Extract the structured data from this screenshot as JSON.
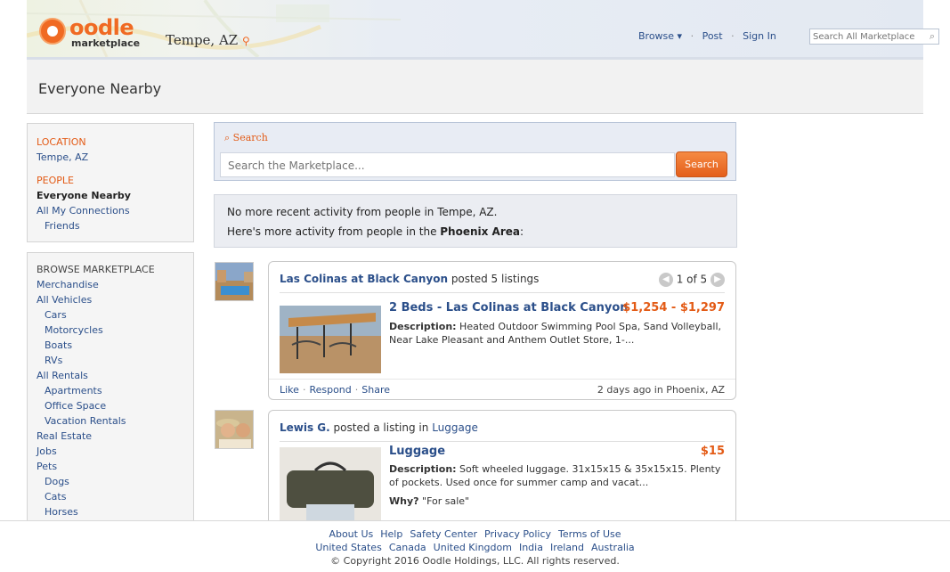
{
  "header": {
    "logo_text": "oodle",
    "logo_subtext": "marketplace",
    "location": "Tempe, AZ",
    "nav": {
      "browse": "Browse ▾",
      "post": "Post",
      "sep": "·",
      "signin": "Sign In"
    },
    "search_placeholder": "Search All Marketplace"
  },
  "page_title": "Everyone Nearby",
  "sidebar": {
    "location_heading": "LOCATION",
    "location_value": "Tempe, AZ",
    "people_heading": "PEOPLE",
    "people_items": [
      "Everyone Nearby",
      "All My Connections",
      "Friends"
    ],
    "browse_heading": "BROWSE MARKETPLACE",
    "browse_items": [
      {
        "label": "Merchandise",
        "indent": false
      },
      {
        "label": "All Vehicles",
        "indent": false
      },
      {
        "label": "Cars",
        "indent": true
      },
      {
        "label": "Motorcycles",
        "indent": true
      },
      {
        "label": "Boats",
        "indent": true
      },
      {
        "label": "RVs",
        "indent": true
      },
      {
        "label": "All Rentals",
        "indent": false
      },
      {
        "label": "Apartments",
        "indent": true
      },
      {
        "label": "Office Space",
        "indent": true
      },
      {
        "label": "Vacation Rentals",
        "indent": true
      },
      {
        "label": "Real Estate",
        "indent": false
      },
      {
        "label": "Jobs",
        "indent": false
      },
      {
        "label": "Pets",
        "indent": false
      },
      {
        "label": "Dogs",
        "indent": true
      },
      {
        "label": "Cats",
        "indent": true
      },
      {
        "label": "Horses",
        "indent": true
      }
    ]
  },
  "search": {
    "label": "Search",
    "placeholder": "Search the Marketplace...",
    "button": "Search"
  },
  "notice": {
    "line1": "No more recent activity from people in Tempe, AZ.",
    "line2_prefix": "Here's more activity from people in the ",
    "line2_bold": "Phoenix Area",
    "line2_suffix": ":"
  },
  "feed": [
    {
      "poster": "Las Colinas at Black Canyon",
      "action": " posted 5 listings",
      "pager": "1 of 5",
      "title": "2 Beds - Las Colinas at Black Canyon",
      "price": "$1,254 - $1,297",
      "desc_label": "Description:",
      "desc": " Heated Outdoor Swimming Pool Spa, Sand Volleyball, Near Lake Pleasant and Anthem Outlet Store, 1-...",
      "actions": [
        "Like",
        "Respond",
        "Share"
      ],
      "meta": "2 days ago in Phoenix, AZ"
    },
    {
      "poster": "Lewis G.",
      "action": " posted a listing in ",
      "category": "Luggage",
      "title": "Luggage",
      "price": "$15",
      "desc_label": "Description:",
      "desc": " Soft wheeled luggage. 31x15x15 & 35x15x15. Plenty of pockets. Used once for summer camp and vacat...",
      "why_label": "Why?",
      "why": "\"For sale\""
    }
  ],
  "footer": {
    "row1": [
      "About Us",
      "Help",
      "Safety Center",
      "Privacy Policy",
      "Terms of Use"
    ],
    "row2": [
      "United States",
      "Canada",
      "United Kingdom",
      "India",
      "Ireland",
      "Australia"
    ],
    "copyright": "© Copyright 2016 Oodle Holdings, LLC. All rights reserved."
  }
}
